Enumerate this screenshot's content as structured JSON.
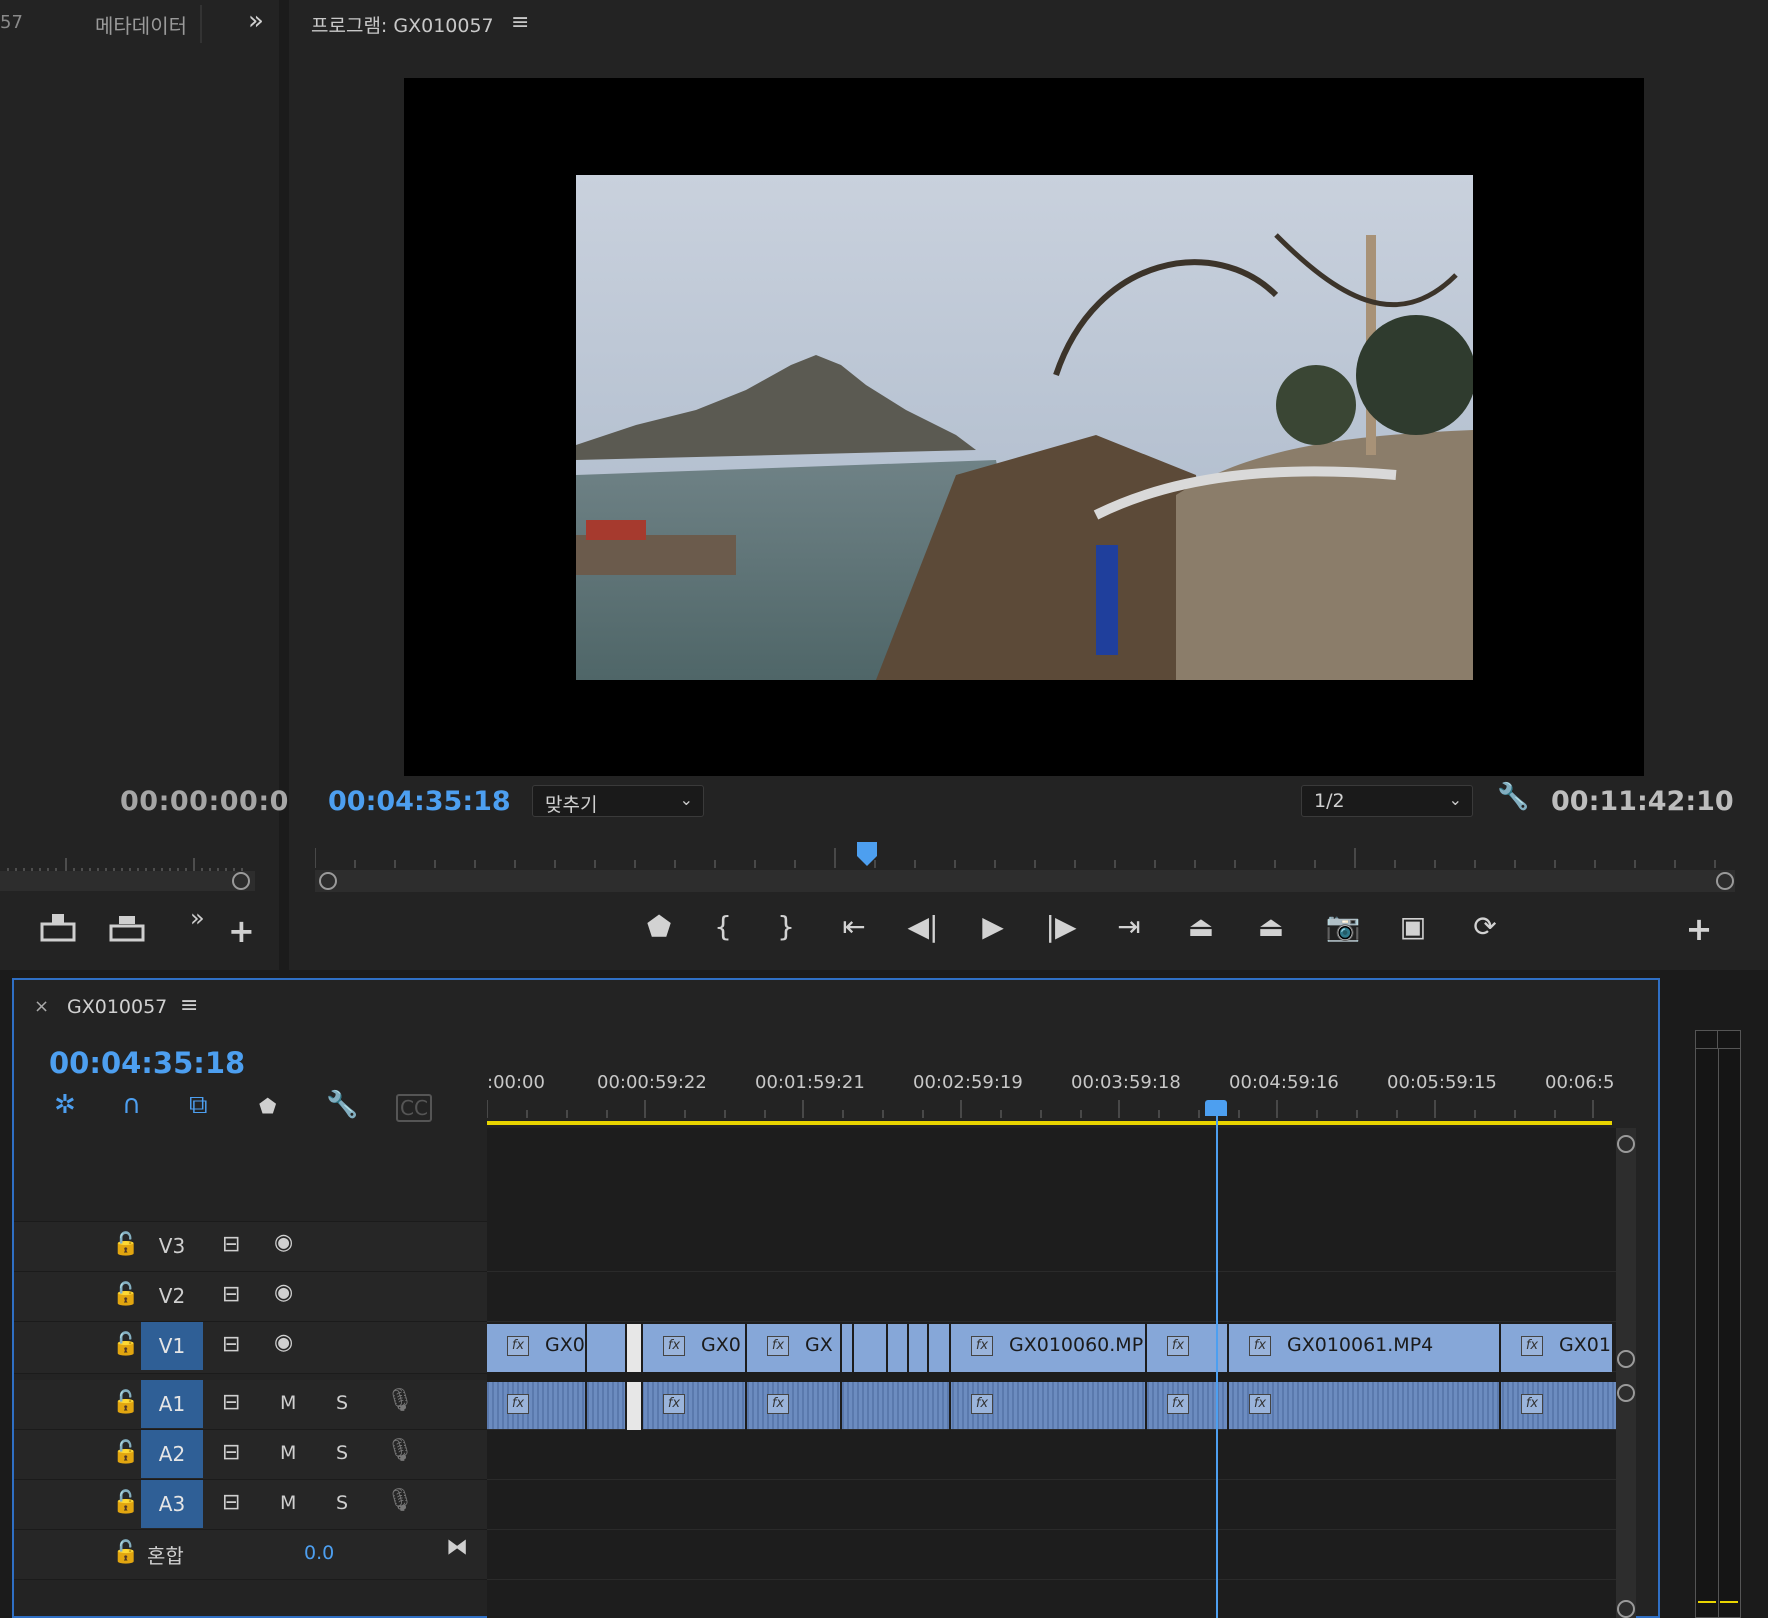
{
  "source_panel": {
    "tab_partial": "57",
    "metadata_tab": "메타데이터",
    "overflow": "»",
    "timecode": "00:00:00:0"
  },
  "program_monitor": {
    "title": "프로그램: GX010057",
    "menu_icon": "hamburger-icon",
    "current_timecode": "00:04:35:18",
    "zoom_select": "맞추기",
    "resolution_select": "1/2",
    "duration": "00:11:42:10"
  },
  "timeline": {
    "sequence_name": "GX010057",
    "current_timecode": "00:04:35:18",
    "ruler_labels": [
      ":00:00",
      "00:00:59:22",
      "00:01:59:21",
      "00:02:59:19",
      "00:03:59:18",
      "00:04:59:16",
      "00:05:59:15",
      "00:06:5"
    ],
    "tracks": {
      "video": [
        {
          "label": "V3"
        },
        {
          "label": "V2"
        },
        {
          "label": "V1"
        }
      ],
      "audio": [
        {
          "label": "A1",
          "mute": "M",
          "solo": "S"
        },
        {
          "label": "A2",
          "mute": "M",
          "solo": "S"
        },
        {
          "label": "A3",
          "mute": "M",
          "solo": "S"
        }
      ],
      "mix": {
        "label": "혼합",
        "value": "0.0"
      }
    },
    "clips": [
      {
        "label": "GX0"
      },
      {
        "label": "GX0"
      },
      {
        "label": "GX"
      },
      {
        "label": "GX010060.MP"
      },
      {
        "label": "GX010061.MP4"
      },
      {
        "label": "GX01"
      }
    ],
    "fx_badge": "fx"
  },
  "colors": {
    "accent_blue": "#4d9ff0",
    "clip_video": "#86a7d8",
    "clip_audio": "#6c8cc0",
    "track_label_active": "#2f5f96"
  }
}
